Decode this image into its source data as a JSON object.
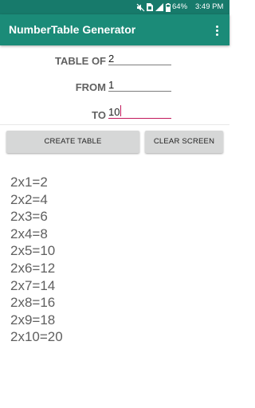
{
  "status_bar": {
    "battery_percent": "64%",
    "time": "3:49 PM",
    "icons": [
      "mute-icon",
      "sim-icon",
      "signal-icon",
      "battery-icon"
    ]
  },
  "app_bar": {
    "title": "NumberTable Generator",
    "menu_icon": "overflow-menu-icon"
  },
  "form": {
    "table_of_label": "TABLE OF",
    "table_of_value": "2",
    "from_label": "FROM",
    "from_value": "1",
    "to_label": "TO",
    "to_value": "10"
  },
  "buttons": {
    "create_label": "CREATE TABLE",
    "clear_label": "CLEAR SCREEN"
  },
  "results": [
    "2x1=2",
    "2x2=4",
    "2x3=6",
    "2x4=8",
    "2x5=10",
    "2x6=12",
    "2x7=14",
    "2x8=16",
    "2x9=18",
    "2x10=20"
  ],
  "colors": {
    "app_bar": "#1b8b78",
    "status_bar": "#177a6b",
    "accent": "#c2185b",
    "button": "#d6d7d7"
  }
}
